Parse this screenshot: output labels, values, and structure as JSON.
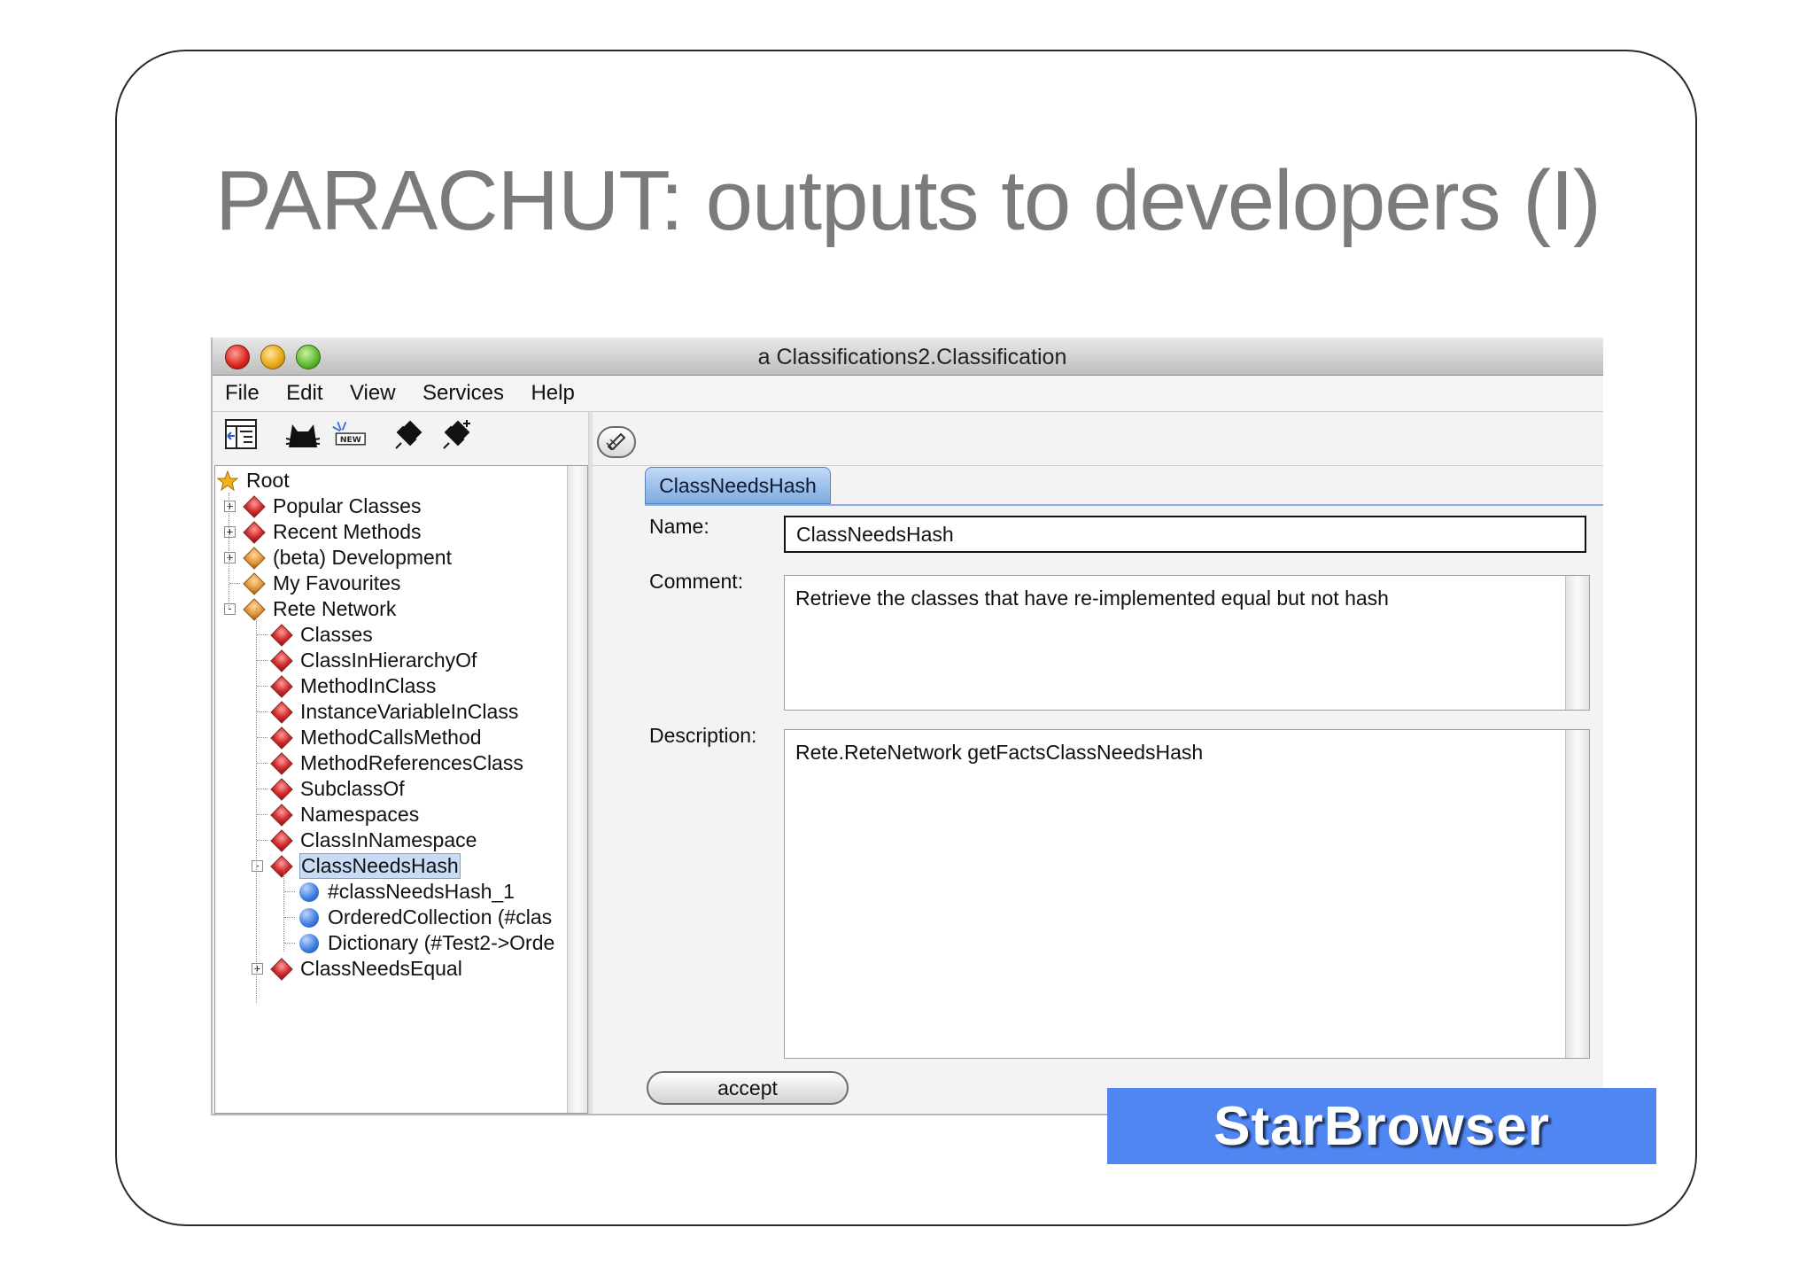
{
  "slide": {
    "title": "PARACHUT: outputs to developers (I)"
  },
  "window": {
    "title": "a Classifications2.Classification"
  },
  "menu": [
    "File",
    "Edit",
    "View",
    "Services",
    "Help"
  ],
  "toolbar": {
    "icons": [
      "tree-browser-icon",
      "cat-icon",
      "new-icon",
      "push-pin-icon",
      "push-pin-add-icon"
    ]
  },
  "tree": {
    "root": "Root",
    "items": [
      {
        "label": "Popular Classes",
        "icon": "diamond-red"
      },
      {
        "label": "Recent Methods",
        "icon": "diamond-red"
      },
      {
        "label": "(beta) Development",
        "icon": "diamond-orange"
      },
      {
        "label": "My Favourites",
        "icon": "diamond-orange"
      },
      {
        "label": "Rete Network",
        "icon": "diamond-orange"
      },
      {
        "label": "Classes",
        "icon": "diamond-red"
      },
      {
        "label": "ClassInHierarchyOf",
        "icon": "diamond-red"
      },
      {
        "label": "MethodInClass",
        "icon": "diamond-red"
      },
      {
        "label": "InstanceVariableInClass",
        "icon": "diamond-red"
      },
      {
        "label": "MethodCallsMethod",
        "icon": "diamond-red"
      },
      {
        "label": "MethodReferencesClass",
        "icon": "diamond-red"
      },
      {
        "label": "SubclassOf",
        "icon": "diamond-red"
      },
      {
        "label": "Namespaces",
        "icon": "diamond-red"
      },
      {
        "label": "ClassInNamespace",
        "icon": "diamond-red"
      },
      {
        "label": "ClassNeedsHash",
        "icon": "diamond-red",
        "selected": true
      },
      {
        "label": "#classNeedsHash_1",
        "icon": "ball-blue"
      },
      {
        "label": "OrderedCollection (#clas",
        "icon": "ball-blue"
      },
      {
        "label": "Dictionary (#Test2->Orde",
        "icon": "ball-blue"
      },
      {
        "label": "ClassNeedsEqual",
        "icon": "diamond-red"
      }
    ]
  },
  "detail": {
    "tab_label": "ClassNeedsHash",
    "name_label": "Name:",
    "name_value": "ClassNeedsHash",
    "comment_label": "Comment:",
    "comment_value": "Retrieve the classes that have re-implemented equal but not hash",
    "description_label": "Description:",
    "description_value": "Rete.ReteNetwork getFactsClassNeedsHash",
    "accept_label": "accept"
  },
  "banner": {
    "text": "StarBrowser",
    "color": "#4f86f2"
  }
}
